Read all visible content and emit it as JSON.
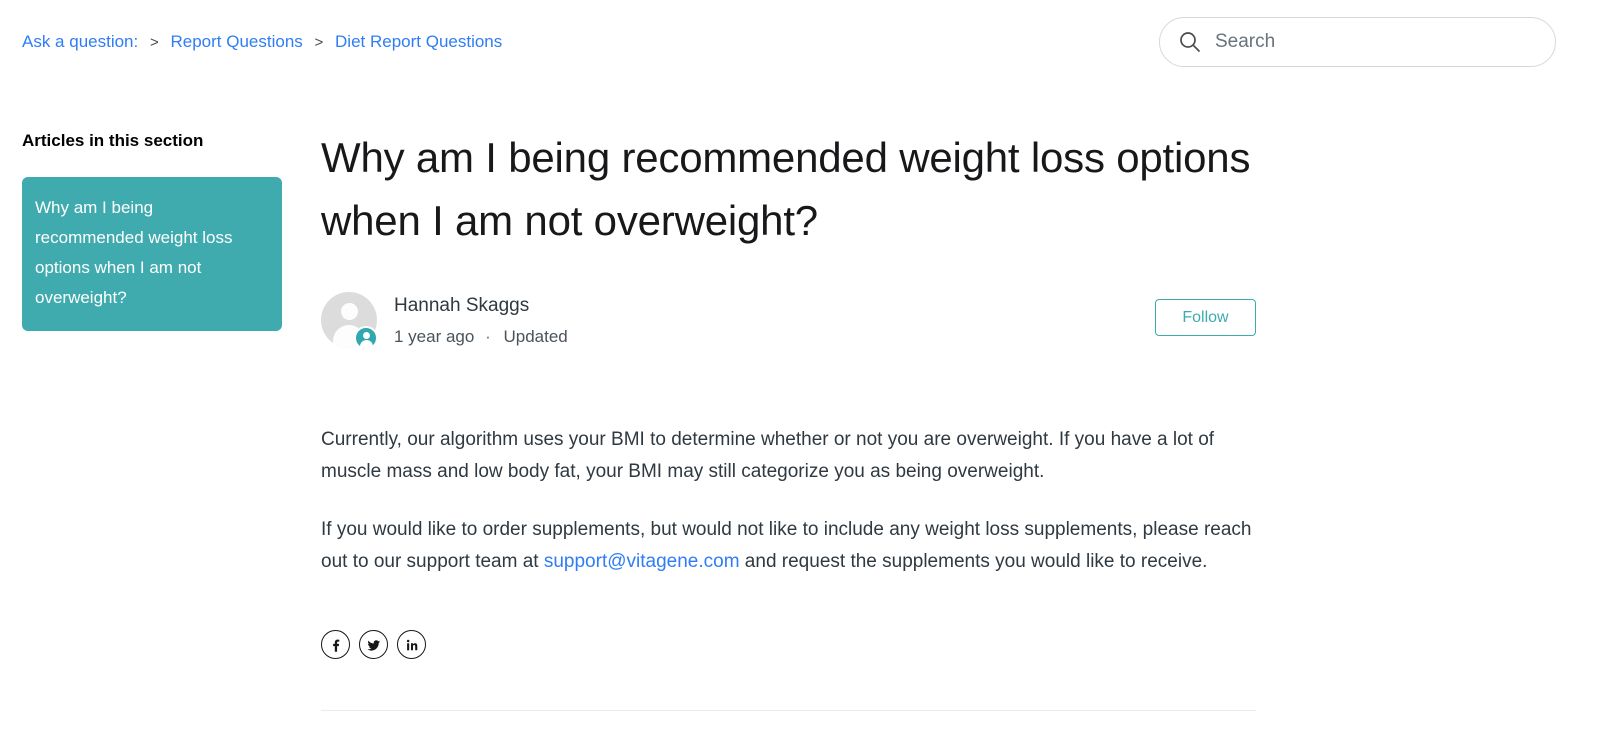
{
  "header": {
    "breadcrumb": {
      "items": [
        {
          "label": "Ask a question:"
        },
        {
          "label": "Report Questions"
        },
        {
          "label": "Diet Report Questions"
        }
      ],
      "separator": ">"
    },
    "search": {
      "placeholder": "Search",
      "value": "",
      "icon": "search-icon"
    }
  },
  "sidebar": {
    "title": "Articles in this section",
    "items": [
      {
        "label": "Why am I being recommended weight loss options when I am not overweight?",
        "active": true
      }
    ]
  },
  "article": {
    "title": "Why am I being recommended weight loss options when I am not overweight?",
    "author": {
      "name": "Hannah Skaggs",
      "avatar_icon": "person-avatar",
      "badge_icon": "agent-badge-icon"
    },
    "timestamp": "1 year ago",
    "separator_dot": "·",
    "status": "Updated",
    "follow_label": "Follow",
    "paragraphs": [
      {
        "parts": [
          {
            "type": "text",
            "text": "Currently, our algorithm uses your BMI to determine whether or not you are overweight. If you have a lot of muscle mass and low body fat, your BMI may still categorize you as being overweight."
          }
        ]
      },
      {
        "parts": [
          {
            "type": "text",
            "text": "If you would like to order supplements, but would not like to include any weight loss supplements, please reach out to our support team at "
          },
          {
            "type": "link",
            "text": "support@vitagene.com"
          },
          {
            "type": "text",
            "text": " and request the supplements you would like to receive."
          }
        ]
      }
    ],
    "share": [
      {
        "name": "facebook-share-icon",
        "label": "f"
      },
      {
        "name": "twitter-share-icon",
        "label": "twitter"
      },
      {
        "name": "linkedin-share-icon",
        "label": "in"
      }
    ]
  },
  "colors": {
    "accent_teal": "#3fabae",
    "badge_teal": "#2fa8b0",
    "link_blue": "#2f7df6",
    "text": "#2f3941",
    "divider": "#e9ebed"
  }
}
